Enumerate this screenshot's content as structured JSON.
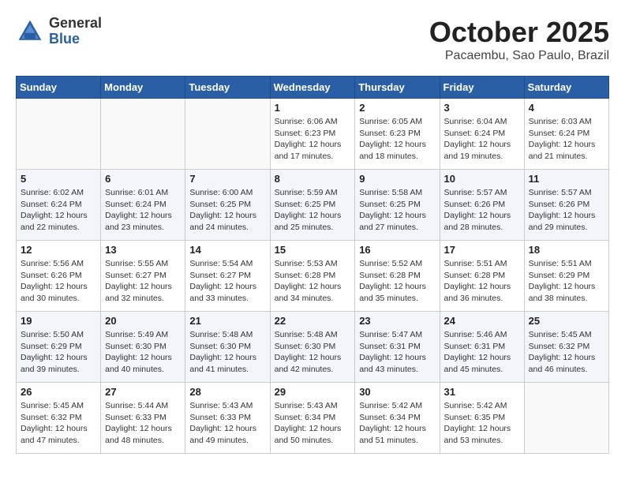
{
  "header": {
    "logo_general": "General",
    "logo_blue": "Blue",
    "month_title": "October 2025",
    "subtitle": "Pacaembu, Sao Paulo, Brazil"
  },
  "days_of_week": [
    "Sunday",
    "Monday",
    "Tuesday",
    "Wednesday",
    "Thursday",
    "Friday",
    "Saturday"
  ],
  "weeks": [
    [
      {
        "day": "",
        "info": ""
      },
      {
        "day": "",
        "info": ""
      },
      {
        "day": "",
        "info": ""
      },
      {
        "day": "1",
        "info": "Sunrise: 6:06 AM\nSunset: 6:23 PM\nDaylight: 12 hours\nand 17 minutes."
      },
      {
        "day": "2",
        "info": "Sunrise: 6:05 AM\nSunset: 6:23 PM\nDaylight: 12 hours\nand 18 minutes."
      },
      {
        "day": "3",
        "info": "Sunrise: 6:04 AM\nSunset: 6:24 PM\nDaylight: 12 hours\nand 19 minutes."
      },
      {
        "day": "4",
        "info": "Sunrise: 6:03 AM\nSunset: 6:24 PM\nDaylight: 12 hours\nand 21 minutes."
      }
    ],
    [
      {
        "day": "5",
        "info": "Sunrise: 6:02 AM\nSunset: 6:24 PM\nDaylight: 12 hours\nand 22 minutes."
      },
      {
        "day": "6",
        "info": "Sunrise: 6:01 AM\nSunset: 6:24 PM\nDaylight: 12 hours\nand 23 minutes."
      },
      {
        "day": "7",
        "info": "Sunrise: 6:00 AM\nSunset: 6:25 PM\nDaylight: 12 hours\nand 24 minutes."
      },
      {
        "day": "8",
        "info": "Sunrise: 5:59 AM\nSunset: 6:25 PM\nDaylight: 12 hours\nand 25 minutes."
      },
      {
        "day": "9",
        "info": "Sunrise: 5:58 AM\nSunset: 6:25 PM\nDaylight: 12 hours\nand 27 minutes."
      },
      {
        "day": "10",
        "info": "Sunrise: 5:57 AM\nSunset: 6:26 PM\nDaylight: 12 hours\nand 28 minutes."
      },
      {
        "day": "11",
        "info": "Sunrise: 5:57 AM\nSunset: 6:26 PM\nDaylight: 12 hours\nand 29 minutes."
      }
    ],
    [
      {
        "day": "12",
        "info": "Sunrise: 5:56 AM\nSunset: 6:26 PM\nDaylight: 12 hours\nand 30 minutes."
      },
      {
        "day": "13",
        "info": "Sunrise: 5:55 AM\nSunset: 6:27 PM\nDaylight: 12 hours\nand 32 minutes."
      },
      {
        "day": "14",
        "info": "Sunrise: 5:54 AM\nSunset: 6:27 PM\nDaylight: 12 hours\nand 33 minutes."
      },
      {
        "day": "15",
        "info": "Sunrise: 5:53 AM\nSunset: 6:28 PM\nDaylight: 12 hours\nand 34 minutes."
      },
      {
        "day": "16",
        "info": "Sunrise: 5:52 AM\nSunset: 6:28 PM\nDaylight: 12 hours\nand 35 minutes."
      },
      {
        "day": "17",
        "info": "Sunrise: 5:51 AM\nSunset: 6:28 PM\nDaylight: 12 hours\nand 36 minutes."
      },
      {
        "day": "18",
        "info": "Sunrise: 5:51 AM\nSunset: 6:29 PM\nDaylight: 12 hours\nand 38 minutes."
      }
    ],
    [
      {
        "day": "19",
        "info": "Sunrise: 5:50 AM\nSunset: 6:29 PM\nDaylight: 12 hours\nand 39 minutes."
      },
      {
        "day": "20",
        "info": "Sunrise: 5:49 AM\nSunset: 6:30 PM\nDaylight: 12 hours\nand 40 minutes."
      },
      {
        "day": "21",
        "info": "Sunrise: 5:48 AM\nSunset: 6:30 PM\nDaylight: 12 hours\nand 41 minutes."
      },
      {
        "day": "22",
        "info": "Sunrise: 5:48 AM\nSunset: 6:30 PM\nDaylight: 12 hours\nand 42 minutes."
      },
      {
        "day": "23",
        "info": "Sunrise: 5:47 AM\nSunset: 6:31 PM\nDaylight: 12 hours\nand 43 minutes."
      },
      {
        "day": "24",
        "info": "Sunrise: 5:46 AM\nSunset: 6:31 PM\nDaylight: 12 hours\nand 45 minutes."
      },
      {
        "day": "25",
        "info": "Sunrise: 5:45 AM\nSunset: 6:32 PM\nDaylight: 12 hours\nand 46 minutes."
      }
    ],
    [
      {
        "day": "26",
        "info": "Sunrise: 5:45 AM\nSunset: 6:32 PM\nDaylight: 12 hours\nand 47 minutes."
      },
      {
        "day": "27",
        "info": "Sunrise: 5:44 AM\nSunset: 6:33 PM\nDaylight: 12 hours\nand 48 minutes."
      },
      {
        "day": "28",
        "info": "Sunrise: 5:43 AM\nSunset: 6:33 PM\nDaylight: 12 hours\nand 49 minutes."
      },
      {
        "day": "29",
        "info": "Sunrise: 5:43 AM\nSunset: 6:34 PM\nDaylight: 12 hours\nand 50 minutes."
      },
      {
        "day": "30",
        "info": "Sunrise: 5:42 AM\nSunset: 6:34 PM\nDaylight: 12 hours\nand 51 minutes."
      },
      {
        "day": "31",
        "info": "Sunrise: 5:42 AM\nSunset: 6:35 PM\nDaylight: 12 hours\nand 53 minutes."
      },
      {
        "day": "",
        "info": ""
      }
    ]
  ]
}
